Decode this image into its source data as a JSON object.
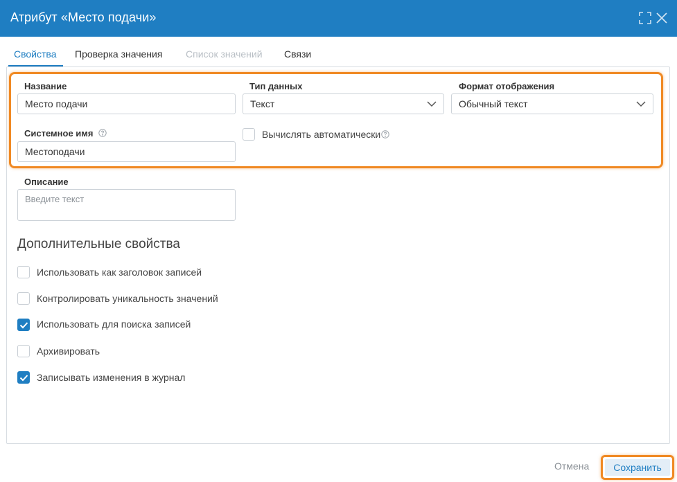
{
  "dialog": {
    "title": "Атрибут «Место подачи»"
  },
  "tabs": [
    {
      "label": "Свойства",
      "state": "active"
    },
    {
      "label": "Проверка значения",
      "state": "normal"
    },
    {
      "label": "Список значений",
      "state": "disabled"
    },
    {
      "label": "Связи",
      "state": "normal"
    }
  ],
  "form": {
    "name_label": "Название",
    "name_value": "Место подачи",
    "datatype_label": "Тип данных",
    "datatype_value": "Текст",
    "format_label": "Формат отображения",
    "format_value": "Обычный текст",
    "sysname_label": "Системное имя",
    "sysname_value": "Местоподачи",
    "auto_calc_label": "Вычислять автоматически",
    "auto_calc_checked": false,
    "description_label": "Описание",
    "description_placeholder": "Введите текст"
  },
  "extra": {
    "title": "Дополнительные свойства",
    "options": [
      {
        "label": "Использовать как заголовок записей",
        "checked": false
      },
      {
        "label": "Контролировать уникальность значений",
        "checked": false
      },
      {
        "label": "Использовать для поиска записей",
        "checked": true
      },
      {
        "label": "Архивировать",
        "checked": false
      },
      {
        "label": "Записывать изменения в журнал",
        "checked": true
      }
    ]
  },
  "footer": {
    "cancel_label": "Отмена",
    "save_label": "Сохранить"
  },
  "colors": {
    "header_bg": "#1f7ec2",
    "accent": "#1f7ec2",
    "highlight": "#f08a24"
  },
  "icons": {
    "expand": "expand-icon",
    "close": "close-icon",
    "help": "help-icon",
    "chevron": "chevron-down-icon",
    "check": "check-icon"
  }
}
